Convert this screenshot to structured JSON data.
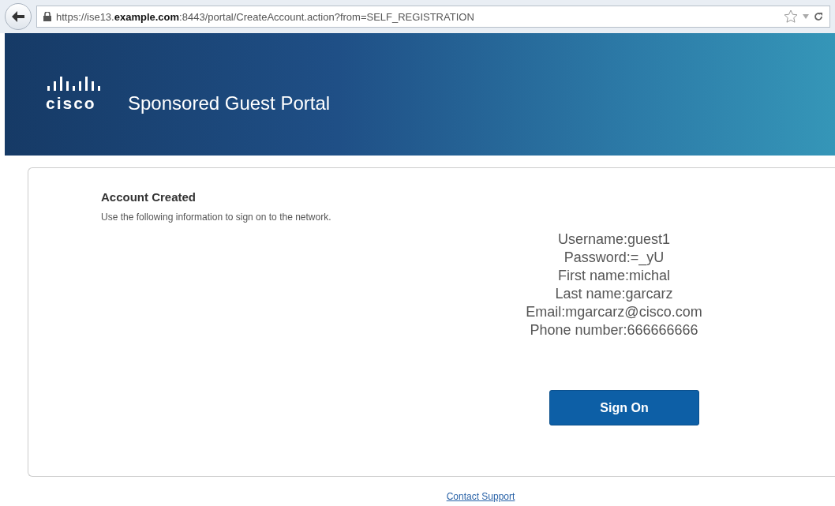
{
  "browser": {
    "url": "https://ise13.**example.com**:8443/portal/CreateAccount.action?from=SELF_REGISTRATION"
  },
  "header": {
    "logo_text": "cisco",
    "title": "Sponsored Guest Portal"
  },
  "card": {
    "heading": "Account Created",
    "instructions": "Use the following information to sign on to the network.",
    "details": [
      "Username:guest1",
      "Password:=_yU",
      "First name:michal",
      "Last name:garcarz",
      "Email:mgarcarz@cisco.com",
      "Phone number:666666666"
    ],
    "button": "Sign On"
  },
  "footer": {
    "link": "Contact Support"
  }
}
